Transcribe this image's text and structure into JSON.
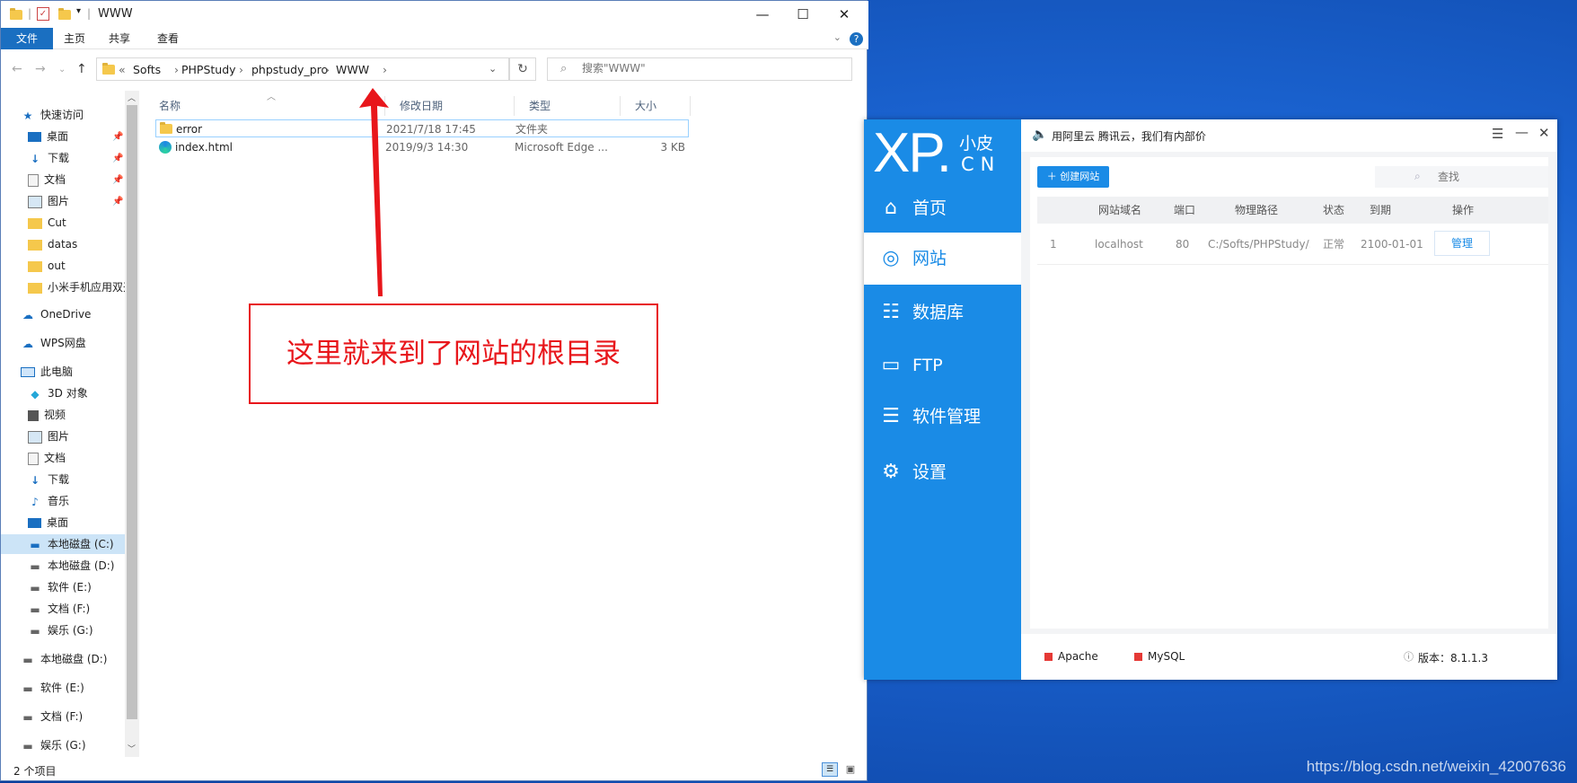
{
  "explorer": {
    "window_title": "WWW",
    "ribbon_tabs": [
      "文件",
      "主页",
      "共享",
      "查看"
    ],
    "breadcrumb": [
      "Softs",
      "PHPStudy",
      "phpstudy_pro",
      "WWW"
    ],
    "search_placeholder": "搜索\"WWW\"",
    "nav_items": [
      {
        "label": "快速访问",
        "icon": "star-icon",
        "pinned": false
      },
      {
        "label": "桌面",
        "icon": "desktop-icon",
        "pinned": true
      },
      {
        "label": "下载",
        "icon": "download-icon",
        "pinned": true
      },
      {
        "label": "文档",
        "icon": "document-icon",
        "pinned": true
      },
      {
        "label": "图片",
        "icon": "picture-icon",
        "pinned": true
      },
      {
        "label": "Cut",
        "icon": "folder-icon",
        "pinned": false
      },
      {
        "label": "datas",
        "icon": "folder-icon",
        "pinned": false
      },
      {
        "label": "out",
        "icon": "folder-icon",
        "pinned": false
      },
      {
        "label": "小米手机应用双开",
        "icon": "folder-icon",
        "pinned": false
      },
      {
        "label": "OneDrive",
        "icon": "cloud-icon",
        "pinned": false
      },
      {
        "label": "WPS网盘",
        "icon": "cloud-icon",
        "pinned": false
      },
      {
        "label": "此电脑",
        "icon": "computer-icon",
        "pinned": false
      },
      {
        "label": "3D 对象",
        "icon": "cube-icon",
        "pinned": false
      },
      {
        "label": "视频",
        "icon": "video-icon",
        "pinned": false
      },
      {
        "label": "图片",
        "icon": "picture-icon",
        "pinned": false
      },
      {
        "label": "文档",
        "icon": "document-icon",
        "pinned": false
      },
      {
        "label": "下载",
        "icon": "download-icon",
        "pinned": false
      },
      {
        "label": "音乐",
        "icon": "music-icon",
        "pinned": false
      },
      {
        "label": "桌面",
        "icon": "desktop-icon",
        "pinned": false
      },
      {
        "label": "本地磁盘 (C:)",
        "icon": "drive-icon",
        "pinned": false
      },
      {
        "label": "本地磁盘 (D:)",
        "icon": "drive-icon",
        "pinned": false
      },
      {
        "label": "软件 (E:)",
        "icon": "drive-icon",
        "pinned": false
      },
      {
        "label": "文档 (F:)",
        "icon": "drive-icon",
        "pinned": false
      },
      {
        "label": "娱乐 (G:)",
        "icon": "drive-icon",
        "pinned": false
      },
      {
        "label": "本地磁盘 (D:)",
        "icon": "drive-icon",
        "pinned": false
      },
      {
        "label": "软件 (E:)",
        "icon": "drive-icon",
        "pinned": false
      },
      {
        "label": "文档 (F:)",
        "icon": "drive-icon",
        "pinned": false
      },
      {
        "label": "娱乐 (G:)",
        "icon": "drive-icon",
        "pinned": false
      }
    ],
    "columns": [
      "名称",
      "修改日期",
      "类型",
      "大小"
    ],
    "files": [
      {
        "name": "error",
        "date": "2021/7/18 17:45",
        "type": "文件夹",
        "size": ""
      },
      {
        "name": "index.html",
        "date": "2019/9/3 14:30",
        "type": "Microsoft Edge ...",
        "size": "3 KB"
      }
    ],
    "status": "2 个项目"
  },
  "annotation": "这里就来到了网站的根目录",
  "xp": {
    "logo_main": "XP.",
    "logo_sub1": "小皮",
    "logo_sub2": "CN",
    "notice": "用阿里云 腾讯云，我们有内部价",
    "nav": [
      {
        "label": "首页",
        "icon": "home-icon"
      },
      {
        "label": "网站",
        "icon": "globe-icon"
      },
      {
        "label": "数据库",
        "icon": "database-icon"
      },
      {
        "label": "FTP",
        "icon": "ftp-icon"
      },
      {
        "label": "软件管理",
        "icon": "sliders-icon"
      },
      {
        "label": "设置",
        "icon": "gear-icon"
      }
    ],
    "create_label": "创建网站",
    "search_placeholder": "查找",
    "table_headers": [
      "网站域名",
      "端口",
      "物理路径",
      "状态",
      "到期",
      "操作"
    ],
    "row": {
      "index": "1",
      "domain": "localhost",
      "port": "80",
      "path": "C:/Softs/PHPStudy/...",
      "status": "正常",
      "expire": "2100-01-01",
      "action": "管理"
    },
    "services": [
      "Apache",
      "MySQL"
    ],
    "version": "版本：8.1.1.3"
  },
  "watermark": "https://blog.csdn.net/weixin_42007636",
  "colors": {
    "accent": "#1a8be6",
    "annotation": "#e8161b",
    "service_stopped": "#e53935"
  }
}
